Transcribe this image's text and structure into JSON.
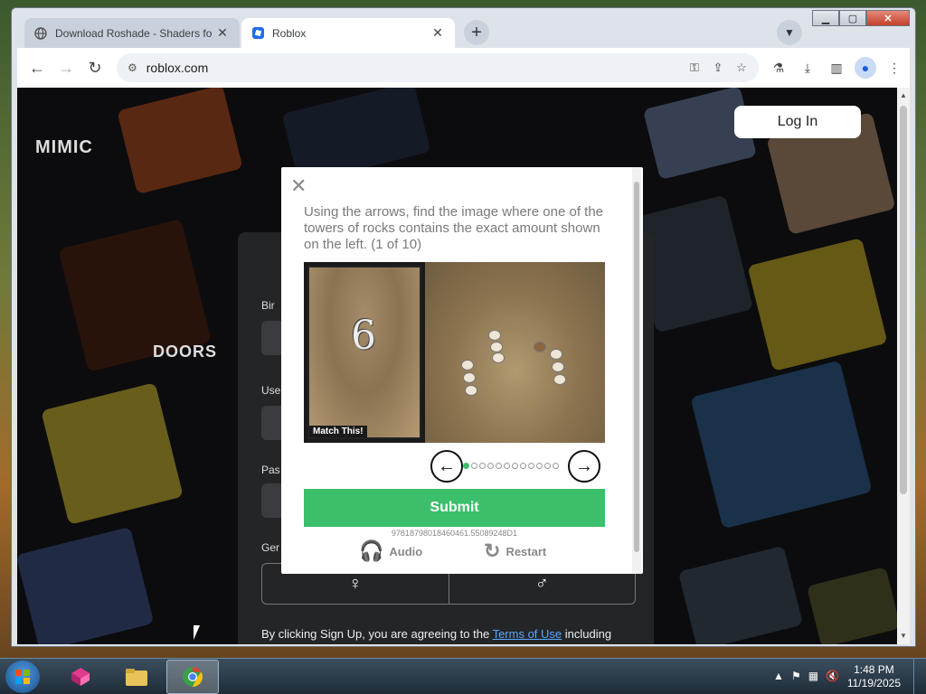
{
  "browser": {
    "tabs": [
      {
        "title": "Download Roshade - Shaders fo",
        "active": false,
        "favicon": "globe-icon"
      },
      {
        "title": "Roblox",
        "active": true,
        "favicon": "roblox-icon"
      }
    ],
    "new_tab": "+",
    "address": "roblox.com"
  },
  "page": {
    "login_label": "Log In",
    "game_labels": {
      "mimic": "MIMIC",
      "doors": "DOORS"
    },
    "form": {
      "birthday_label": "Bir",
      "username_label": "Use",
      "password_label": "Pas",
      "gender_label": "Ger",
      "terms_prefix": "By clicking Sign Up, you are agreeing to the ",
      "terms_link": "Terms of Use",
      "terms_suffix": " including"
    }
  },
  "captcha": {
    "instruction": "Using the arrows, find the image where one of the towers of rocks contains the exact amount shown on the left. (1 of 10)",
    "match_digit": "6",
    "match_label": "Match This!",
    "progress": {
      "current": 1,
      "total": 12
    },
    "submit_label": "Submit",
    "session_id": "97818798018460461.55089248D1",
    "audio_label": "Audio",
    "restart_label": "Restart"
  },
  "taskbar": {
    "time": "1:48 PM",
    "date": "11/19/2025"
  },
  "colors": {
    "submit_green": "#3bbf6b",
    "link_blue": "#5aa7ff",
    "page_dark": "#1b1c1f"
  }
}
